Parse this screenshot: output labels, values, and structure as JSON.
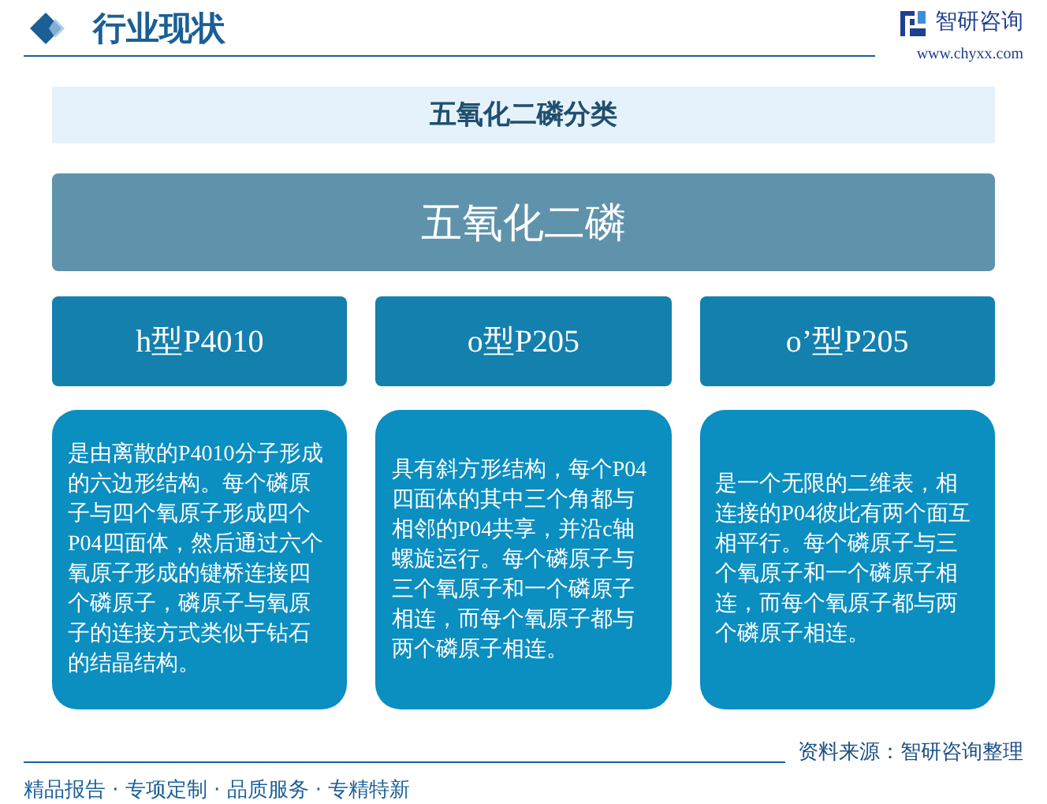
{
  "header": {
    "title": "行业现状",
    "brand": "智研咨询",
    "url": "www.chyxx.com"
  },
  "banner": {
    "title": "五氧化二磷分类"
  },
  "main": {
    "title": "五氧化二磷"
  },
  "types": [
    {
      "name": "h型P4010",
      "description": "是由离散的P4010分子形成的六边形结构。每个磷原子与四个氧原子形成四个P04四面体，然后通过六个氧原子形成的键桥连接四个磷原子，磷原子与氧原子的连接方式类似于钻石的结晶结构。"
    },
    {
      "name": "o型P205",
      "description": "具有斜方形结构，每个P04四面体的其中三个角都与相邻的P04共享，并沿c轴螺旋运行。每个磷原子与三个氧原子和一个磷原子相连，而每个氧原子都与两个磷原子相连。"
    },
    {
      "name": "o’型P205",
      "description": "是一个无限的二维表，相连接的P04彼此有两个面互相平行。每个磷原子与三个氧原子和一个磷原子相连，而每个氧原子都与两个磷原子相连。"
    }
  ],
  "footer": {
    "source": "资料来源：智研咨询整理",
    "slogan": "精品报告 · 专项定制 · 品质服务 · 专精特新"
  }
}
